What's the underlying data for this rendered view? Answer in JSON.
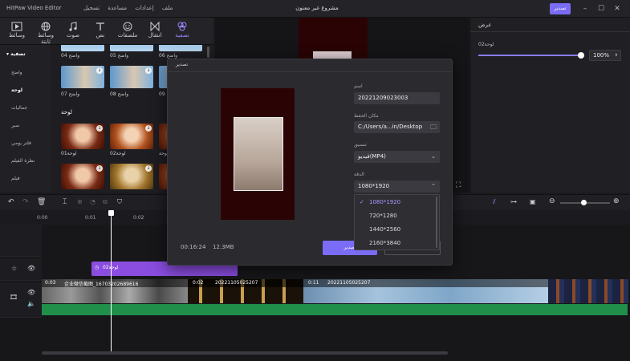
{
  "titlebar": {
    "app_name": "HitPaw Video Editor",
    "menu": [
      "ملف",
      "إعدادات",
      "مساعدة",
      "تسجيل"
    ],
    "project_title": "مشروع غير معنون",
    "export_label": "تصدير",
    "window_buttons": [
      "minimize-icon",
      "maximize-icon",
      "close-icon"
    ]
  },
  "tools": [
    {
      "label": "وسائط",
      "icon": "media-icon"
    },
    {
      "label": "وسائط ثابتة",
      "icon": "stock-icon"
    },
    {
      "label": "صوت",
      "icon": "music-icon"
    },
    {
      "label": "نص",
      "icon": "text-icon"
    },
    {
      "label": "ملصقات",
      "icon": "sticker-icon"
    },
    {
      "label": "انتقال",
      "icon": "transition-icon"
    },
    {
      "label": "تصفية",
      "icon": "filter-icon",
      "active": true
    }
  ],
  "categories": [
    {
      "label": "تصفية",
      "selected": true
    },
    {
      "label": "واضح"
    },
    {
      "label": "لوحة",
      "selected": true
    },
    {
      "label": "جماليات"
    },
    {
      "label": "سير"
    },
    {
      "label": "فلتر يومي"
    },
    {
      "label": "نظرة الفيلم"
    },
    {
      "label": "فيلم"
    }
  ],
  "thumbs": {
    "row1_labels": [
      "واضح 04",
      "واضح 05",
      "واضح 06"
    ],
    "row2_labels": [
      "واضح 07",
      "واضح 08",
      "واضح 09"
    ],
    "section_title": "لوحة",
    "row3_labels": [
      "لوحة01",
      "لوحة02",
      "لوحة"
    ]
  },
  "right_panel": {
    "header": "عرض",
    "label": "لوحة02",
    "slider_fraction": 1.0,
    "percent": "100%"
  },
  "dialog": {
    "title": "تصدير",
    "name_label": "اسم",
    "name_value": "20221209023003",
    "location_label": "مكان الحفظ",
    "location_value": "C:/Users/a...in/Desktop",
    "format_label": "تنسيق",
    "format_value": "فيديو(MP4)",
    "resolution_label": "الدقة",
    "resolution_value": "1080*1920",
    "resolution_options": [
      "1080*1920",
      "720*1280",
      "1440*2560",
      "2160*3840"
    ],
    "duration": "00:16:24",
    "size": "12.3MB",
    "export_button": "تصدير"
  },
  "timeline": {
    "ruler_labels": [
      "0:00",
      "0:01",
      "0:02"
    ],
    "text_clip_label": "لوحة02",
    "clips": [
      {
        "duration": "0:03",
        "name": "企业微信截图_16703202689616"
      },
      {
        "duration": "0:02",
        "name": "20221105025207"
      },
      {
        "duration": "0:11",
        "name": "20221105025207"
      }
    ]
  },
  "colors": {
    "accent": "#7b6cf6",
    "text_clip": "#8a4de0",
    "audio": "#1f8f4a"
  }
}
